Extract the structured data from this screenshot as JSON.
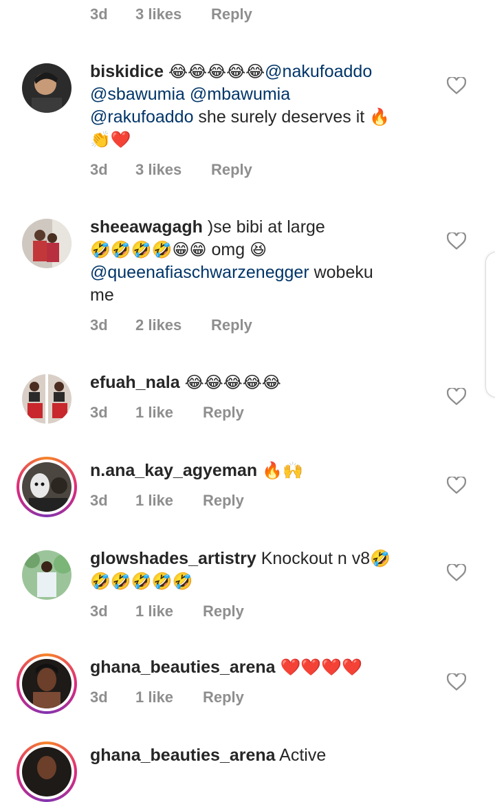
{
  "top_meta": {
    "time": "3d",
    "likes": "3 likes",
    "reply": "Reply"
  },
  "comments": [
    {
      "username": "biskidice",
      "lines": [
        {
          "emoji": "😂😂😂😂😂",
          "mention": "@nakufoaddo"
        },
        {
          "mention1": "@sbawumia",
          "mention2": "@mbawumia"
        },
        {
          "mention": "@rakufoaddo",
          "text": " she surely deserves it ",
          "emoji": "🔥"
        },
        {
          "emoji": "👏❤️"
        }
      ],
      "time": "3d",
      "likes": "3 likes",
      "reply": "Reply",
      "avatar_ring": false
    },
    {
      "username": "sheeawagagh",
      "lines": [
        {
          "text": " )se bibi at large"
        },
        {
          "emoji": "🤣🤣🤣🤣😁😁",
          "text": " omg ",
          "emoji2": "😆"
        },
        {
          "mention": "@queenafiaschwarzenegger",
          "text": "  wobeku"
        },
        {
          "text": "me"
        }
      ],
      "time": "3d",
      "likes": "2 likes",
      "reply": "Reply",
      "avatar_ring": false
    },
    {
      "username": "efuah_nala",
      "lines": [
        {
          "emoji": "😂😂😂😂😂"
        }
      ],
      "time": "3d",
      "likes": "1 like",
      "reply": "Reply",
      "avatar_ring": false
    },
    {
      "username": "n.ana_kay_agyeman",
      "lines": [
        {
          "emoji": "🔥🙌"
        }
      ],
      "time": "3d",
      "likes": "1 like",
      "reply": "Reply",
      "avatar_ring": true
    },
    {
      "username": "glowshades_artistry",
      "lines": [
        {
          "text": " Knockout n v8",
          "emoji": "🤣"
        },
        {
          "emoji": "🤣🤣🤣🤣🤣"
        }
      ],
      "time": "3d",
      "likes": "1 like",
      "reply": "Reply",
      "avatar_ring": false
    },
    {
      "username": "ghana_beauties_arena",
      "lines": [
        {
          "emoji": "❤️❤️❤️❤️"
        }
      ],
      "time": "3d",
      "likes": "1 like",
      "reply": "Reply",
      "avatar_ring": true
    },
    {
      "username": "ghana_beauties_arena",
      "lines": [
        {
          "text": " Active"
        }
      ],
      "avatar_ring": true
    }
  ],
  "colors": {
    "text": "#262626",
    "mention": "#003569",
    "meta": "#8e8e8e",
    "heart": "#8e8e8e"
  },
  "icons": {
    "like": "heart-outline-icon"
  }
}
